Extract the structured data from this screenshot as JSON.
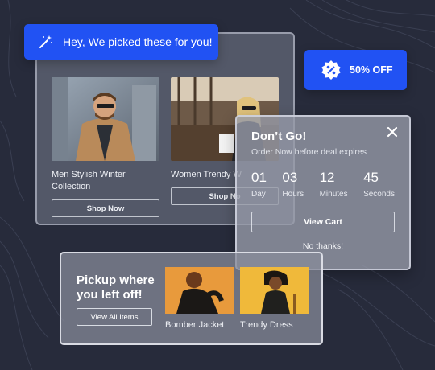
{
  "banner": {
    "text": "Hey, We picked these for you!",
    "icon": "magic-wand-icon",
    "color": "#2152f3"
  },
  "products": [
    {
      "name": "Men Stylish Winter Collection",
      "button": "Shop Now"
    },
    {
      "name": "Women Trendy W",
      "button": "Shop No"
    }
  ],
  "discount": {
    "text": "50% OFF",
    "icon": "percent-badge-icon"
  },
  "popup": {
    "title": "Don’t Go!",
    "subtitle": "Order Now before deal expires",
    "countdown": [
      {
        "value": "01",
        "unit": "Day"
      },
      {
        "value": "03",
        "unit": "Hours"
      },
      {
        "value": "12",
        "unit": "Minutes"
      },
      {
        "value": "45",
        "unit": "Seconds"
      }
    ],
    "cart_button": "View Cart",
    "dismiss": "No thanks!"
  },
  "pickup": {
    "heading": "Pickup where you left off!",
    "view_all": "View All Items",
    "items": [
      {
        "label": "Bomber Jacket"
      },
      {
        "label": "Trendy Dress"
      }
    ]
  }
}
